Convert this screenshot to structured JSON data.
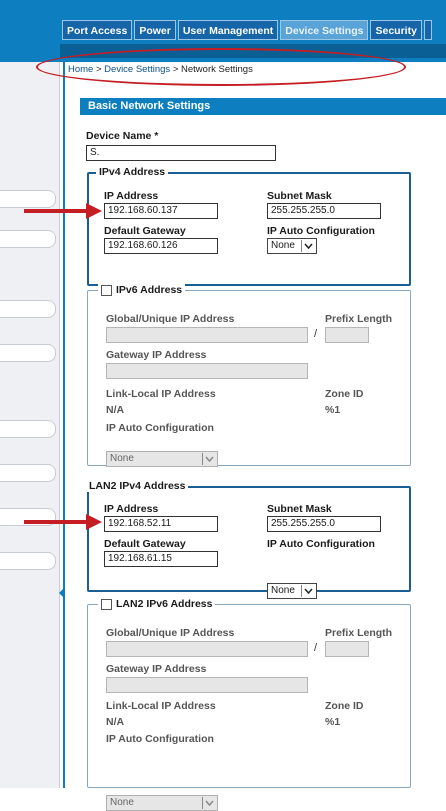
{
  "tabs": [
    {
      "label": "Port Access",
      "active": false
    },
    {
      "label": "Power",
      "active": false
    },
    {
      "label": "User Management",
      "active": false
    },
    {
      "label": "Device Settings",
      "active": true
    },
    {
      "label": "Security",
      "active": false
    }
  ],
  "breadcrumb": {
    "home": "Home",
    "sep": " > ",
    "device_settings": "Device Settings",
    "current": "Network Settings"
  },
  "section_title": "Basic Network Settings",
  "device_name": {
    "label": "Device Name *",
    "value": "S."
  },
  "ipv4": {
    "legend": "IPv4 Address",
    "ip_label": "IP Address",
    "ip_value": "192.168.60.137",
    "mask_label": "Subnet Mask",
    "mask_value": "255.255.255.0",
    "gateway_label": "Default Gateway",
    "gateway_value": "192.168.60.126",
    "auto_label": "IP Auto Configuration",
    "auto_value": "None"
  },
  "ipv6": {
    "legend": "IPv6 Address",
    "global_label": "Global/Unique IP Address",
    "prefix_label": "Prefix Length",
    "slash": "/",
    "gateway_label": "Gateway IP Address",
    "link_local_label": "Link-Local IP Address",
    "link_local_value": "N/A",
    "zone_label": "Zone ID",
    "zone_value": "%1",
    "auto_label": "IP Auto Configuration",
    "auto_value": "None"
  },
  "lan2_ipv4": {
    "legend": "LAN2 IPv4 Address",
    "ip_label": "IP Address",
    "ip_value": "192.168.52.11",
    "mask_label": "Subnet Mask",
    "mask_value": "255.255.255.0",
    "gateway_label": "Default Gateway",
    "gateway_value": "192.168.61.15",
    "auto_label": "IP Auto Configuration",
    "auto_value": "None"
  },
  "lan2_ipv6": {
    "legend": "LAN2 IPv6 Address",
    "global_label": "Global/Unique IP Address",
    "prefix_label": "Prefix Length",
    "slash": "/",
    "gateway_label": "Gateway IP Address",
    "link_local_label": "Link-Local IP Address",
    "link_local_value": "N/A",
    "zone_label": "Zone ID",
    "zone_value": "%1",
    "auto_label": "IP Auto Configuration",
    "auto_value": "None"
  },
  "colors": {
    "header_blue": "#0d7fc0",
    "annotation_red": "#c51d24",
    "fieldset_blue": "#1b5e93"
  },
  "icons": {
    "dropdown": "chevron-down-icon",
    "annotation": "red-arrow-icon",
    "collapse": "collapse-arrow-icon"
  }
}
